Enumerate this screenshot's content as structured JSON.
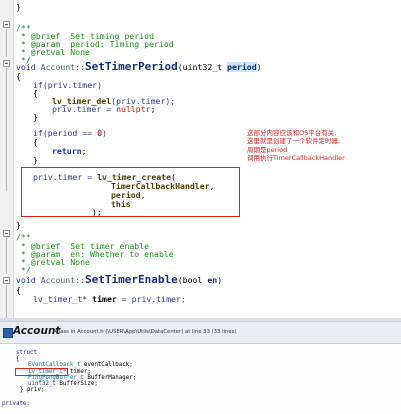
{
  "editor": {
    "lines": {
      "l0": "}",
      "l2": "/**",
      "l3a": " * @brief  Set timing period",
      "l4a": " * @param  period: Timing period",
      "l5a": " * @retval None",
      "l6": " */",
      "l7_void": "void ",
      "l7_cls": "Account::",
      "l7_fn": "SetTimerPeriod",
      "l7_rest1": "(uint32_t ",
      "l7_param": "period",
      "l7_rest2": ")",
      "l8": "{",
      "l9_if": "if",
      "l9_rest": "(priv.timer)",
      "l10": "{",
      "l11_fn": "lv_timer_del",
      "l11_rest": "(priv.timer);",
      "l12_a": "priv.timer = ",
      "l12_b": "nullptr",
      "l12_c": ";",
      "l13": "}",
      "l15_if": "if",
      "l15_a": "(period == ",
      "l15_num": "0",
      "l15_b": ")",
      "l16": "{",
      "l17_kw": "return",
      "l17_rest": ";",
      "l18": "}",
      "l20_a": "priv.timer = ",
      "l20_fn": "lv_timer_create",
      "l20_b": "(",
      "l21_fn": "TimerCallbackHandler",
      "l21_b": ",",
      "l22_a": "period",
      "l22_b": ",",
      "l23_kw": "this",
      "l24": ");",
      "l25": "}",
      "l27": "/**",
      "l28": " * @brief  Set timer enable",
      "l29": " * @param  en: Whether to enable",
      "l30": " * @retval None",
      "l31": " */",
      "l32_void": "void ",
      "l32_cls": "Account::",
      "l32_fn": "SetTimerEnable",
      "l32_rest1": "(bool ",
      "l32_param": "en",
      "l32_rest2": ")",
      "l33": "{",
      "l34_a": "lv_timer_t* ",
      "l34_b": "timer",
      "l34_c": " = priv.timer;"
    },
    "annotation": [
      "这部分内容应该和OS平台有关,",
      "这里就是创建了一个软件定时器,",
      "周期是period",
      "调用执行TimerCallbackHandler"
    ]
  },
  "toolbar": {
    "title": "Account",
    "info": "Class in Account.h (\\USER\\App\\Utils\\DataCenter) at line 33 (33 lines)"
  },
  "preview": {
    "lines": {
      "p0": "struct",
      "p1": "{",
      "p2_t": "EventCallback_t ",
      "p2_v": "eventCallback;",
      "p3_t": "lv_timer_t* ",
      "p3_v": "timer;",
      "p4_t": "PingPongBuffer_t ",
      "p4_v": "BufferManager;",
      "p5_t": "uint32_t ",
      "p5_v": "BufferSize;",
      "p6": "} priv;",
      "p8": "private:"
    }
  },
  "colors": {
    "annotation_red": "#e02020",
    "keyword_blue": "#1a35a6",
    "comment_green": "#1f8f1f"
  }
}
